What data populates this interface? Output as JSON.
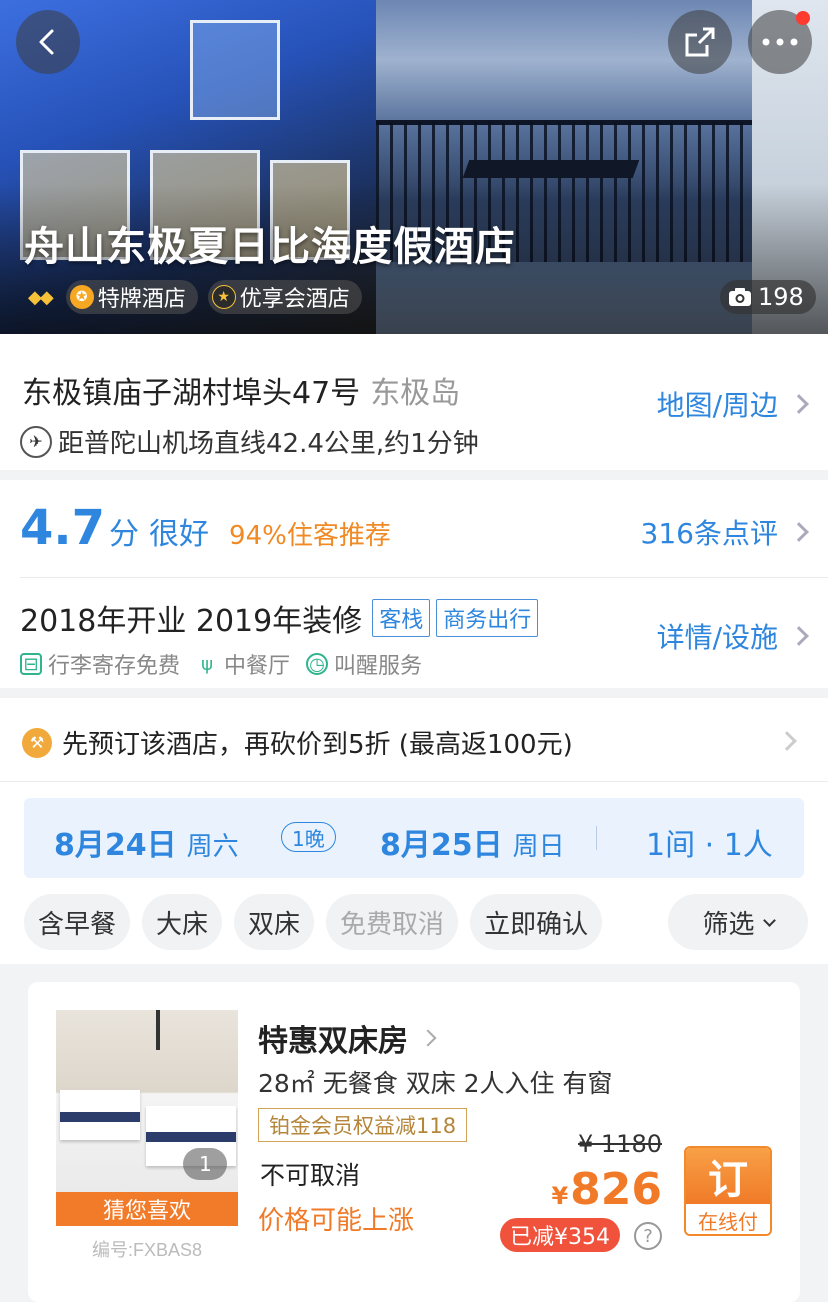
{
  "hero": {
    "title": "舟山东极夏日比海度假酒店",
    "diamonds": "◆◆",
    "badges": [
      {
        "label": "特牌酒店",
        "icon": "gold-medal-icon",
        "color": "#f7a823"
      },
      {
        "label": "优享会酒店",
        "icon": "star-icon",
        "color": "#2b2b2b"
      }
    ],
    "photo_count": "198"
  },
  "location": {
    "address": "东极镇庙子湖村埠头47号",
    "area": "东极岛",
    "map_link": "地图/周边",
    "airport": "距普陀山机场直线42.4公里,约1分钟"
  },
  "rating": {
    "score": "4.7",
    "unit": "分",
    "word": "很好",
    "recommend": "94%住客推荐",
    "reviews_link": "316条点评"
  },
  "facilities": {
    "open_year": "2018年开业 2019年装修",
    "tags": [
      "客栈",
      "商务出行"
    ],
    "detail_link": "详情/设施",
    "amenities": [
      {
        "label": "行李寄存免费",
        "icon": "luggage-icon"
      },
      {
        "label": "中餐厅",
        "icon": "utensils-icon"
      },
      {
        "label": "叫醒服务",
        "icon": "alarm-clock-icon"
      }
    ]
  },
  "promo": {
    "text": "先预订该酒店，再砍价到5折 (最高返100元)"
  },
  "booking": {
    "checkin_date": "8月24日",
    "checkin_weekday": "周六",
    "nights": "1晚",
    "checkout_date": "8月25日",
    "checkout_weekday": "周日",
    "rooms_guests": "1间 · 1人"
  },
  "filters": {
    "chips": [
      "含早餐",
      "大床",
      "双床",
      "免费取消",
      "立即确认"
    ],
    "disabled_chip": "免费取消",
    "filter_button": "筛选"
  },
  "room": {
    "image_count": "1",
    "guess_label": "猜您喜欢",
    "code": "编号:FXBAS8",
    "name": "特惠双床房",
    "specs": "28㎡  无餐食 双床 2人入住 有窗",
    "member_badge": "铂金会员权益减118",
    "cancel_policy": "不可取消",
    "price_warning": "价格可能上涨",
    "original_price": "¥ 1180",
    "currency": "¥",
    "price": "826",
    "discount": "已减¥354",
    "book_label": "订",
    "book_sub": "在线付"
  },
  "colors": {
    "accent_blue": "#2e86de",
    "accent_orange": "#f07a28",
    "discount_red": "#f0523b"
  }
}
